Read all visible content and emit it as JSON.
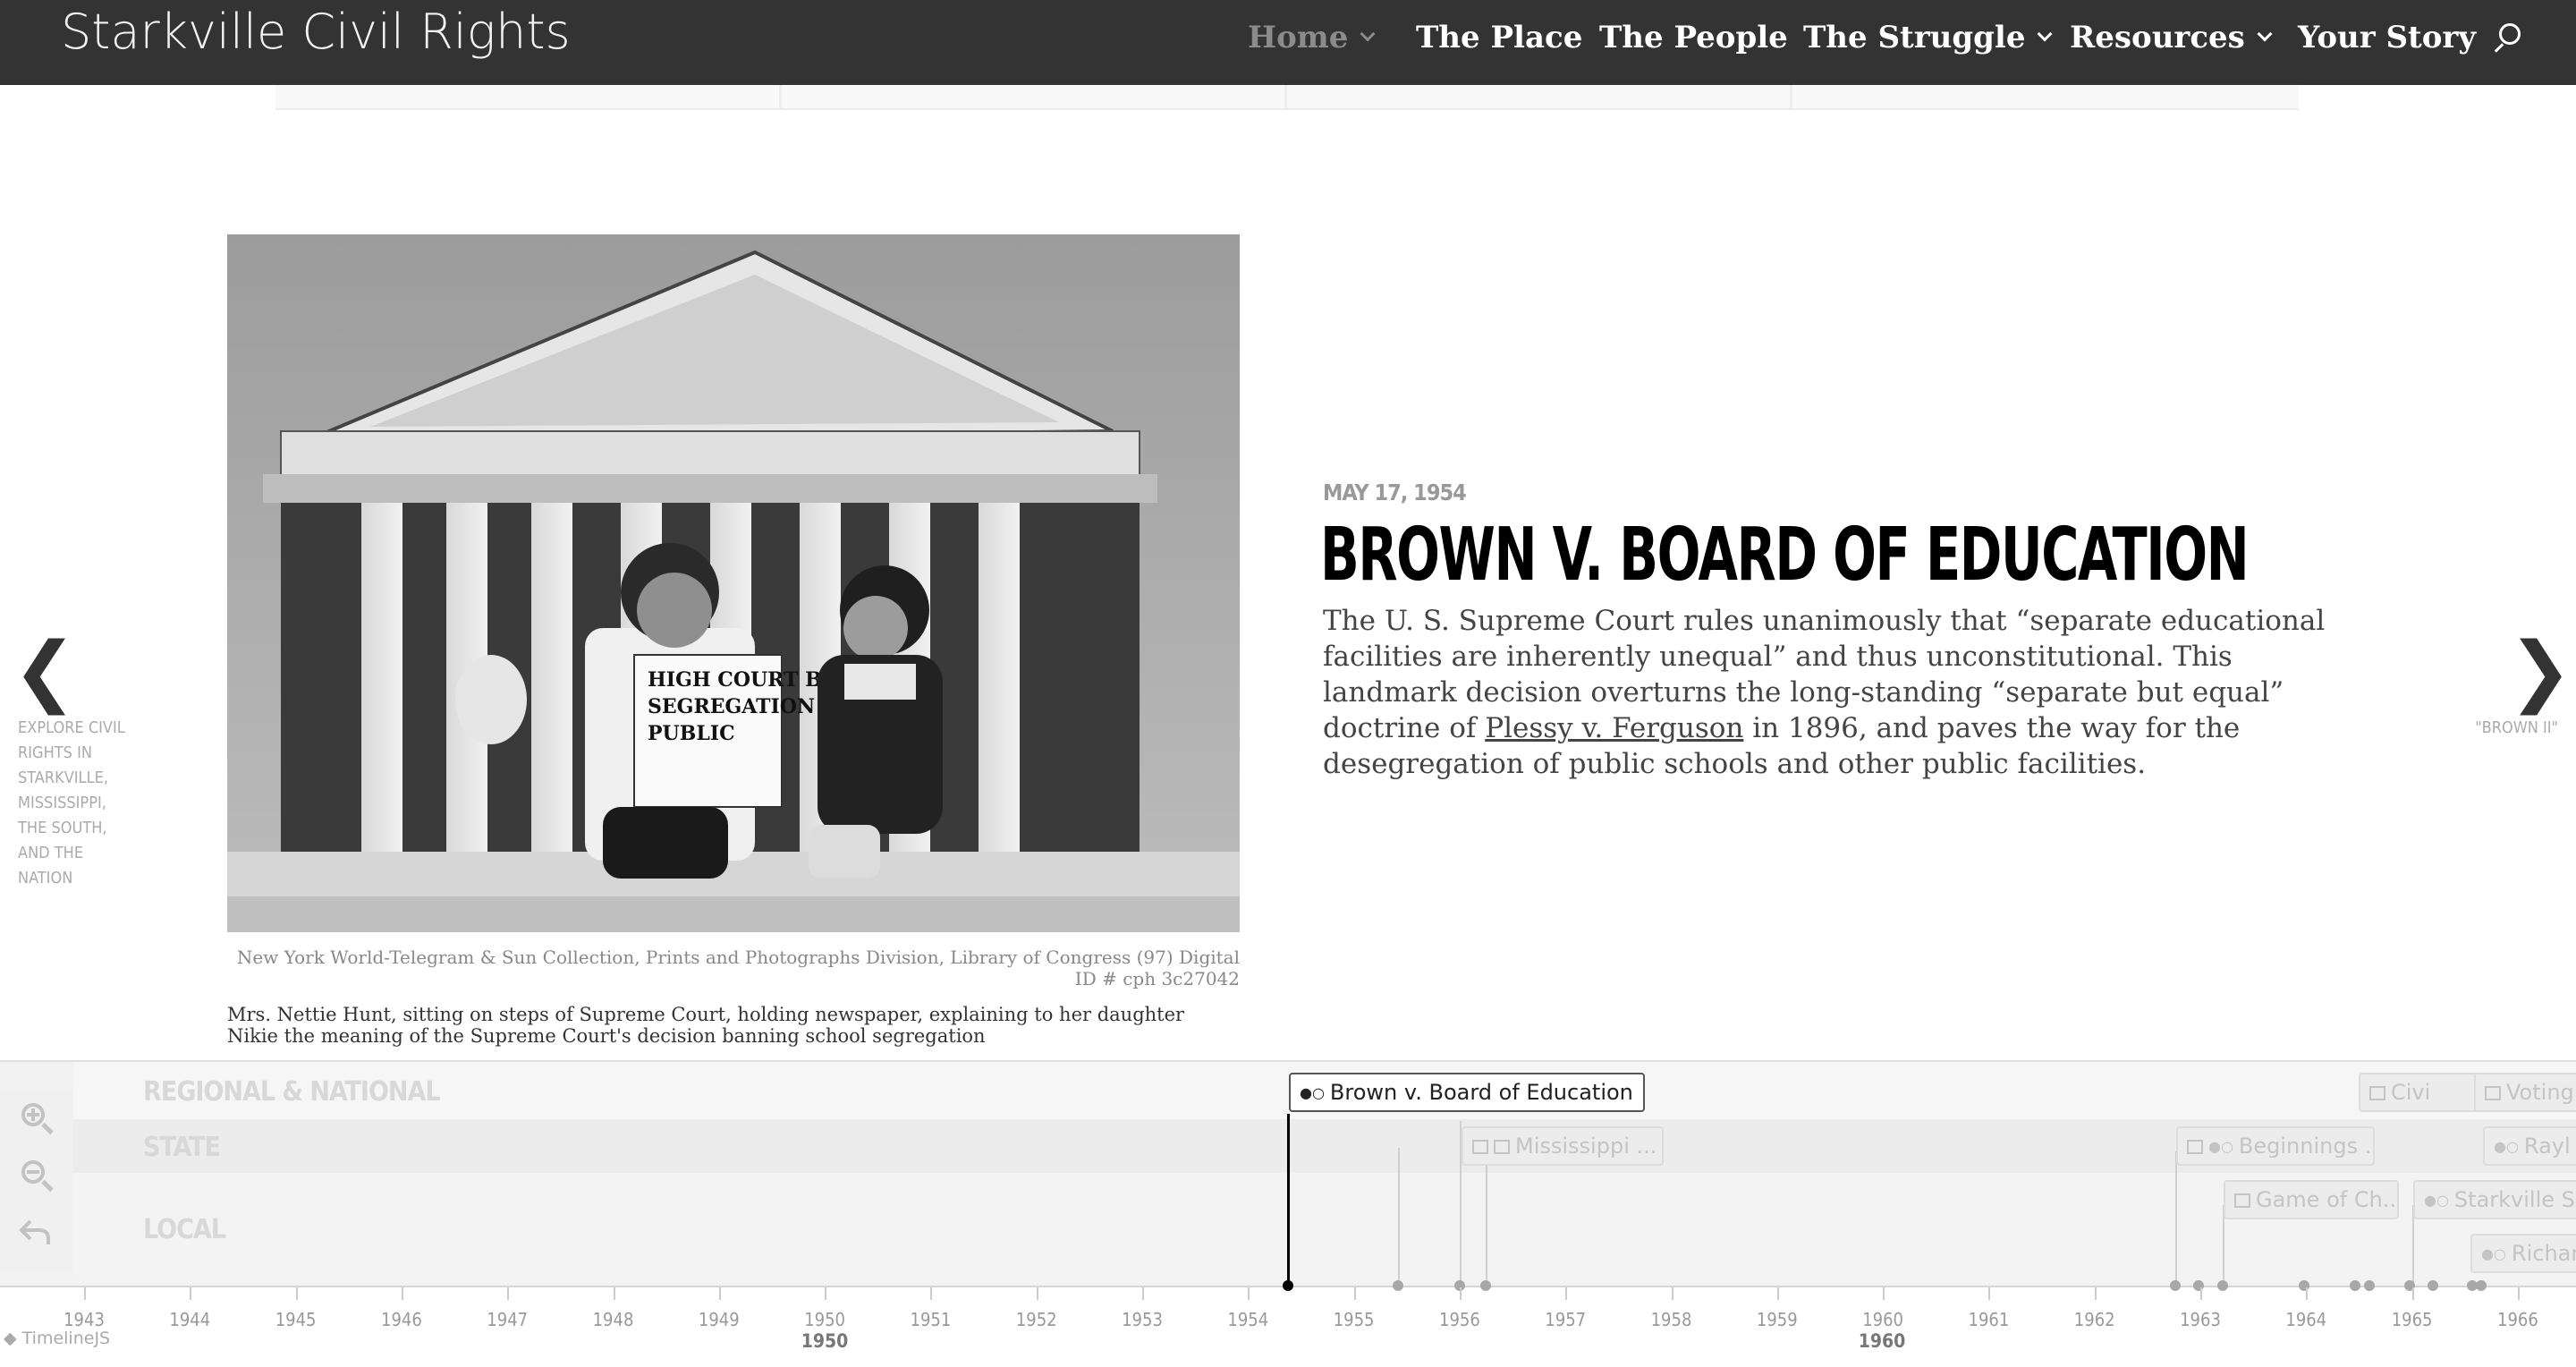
{
  "header": {
    "site_title": "Starkville Civil Rights",
    "nav": [
      {
        "label": "Home",
        "has_dropdown": true,
        "active": true
      },
      {
        "label": "The Place",
        "has_dropdown": false
      },
      {
        "label": "The People",
        "has_dropdown": false
      },
      {
        "label": "The Struggle",
        "has_dropdown": true
      },
      {
        "label": "Resources",
        "has_dropdown": true
      },
      {
        "label": "Your Story",
        "has_dropdown": false
      }
    ],
    "search_icon": "search-icon"
  },
  "slide": {
    "image_alt": "Mrs. Nettie Hunt with daughter Nikie on steps of Supreme Court",
    "newspaper_text": "HIGH COURT BANS SEGREGATION IN PUBLIC",
    "credit": "New York World-Telegram & Sun Collection, Prints and Photographs Division, Library of Congress (97) Digital ID # cph 3c27042",
    "caption": "Mrs. Nettie Hunt, sitting on steps of Supreme Court, holding newspaper, explaining to her daughter Nikie the meaning of the Supreme Court's decision banning school segregation",
    "date": "MAY 17, 1954",
    "headline": "BROWN V. BOARD OF EDUCATION",
    "body_pre": "The U. S. Supreme Court rules unanimously that “separate educational facilities are inherently unequal” and thus unconstitutional. This landmark decision overturns the long-standing “separate but equal” doctrine of ",
    "body_link": "Plessy v. Ferguson",
    "body_post": " in 1896, and paves the way for the desegregation of public schools and other public facilities.",
    "prev_label": "EXPLORE CIVIL RIGHTS IN STARKVILLE, MISSISSIPPI, THE SOUTH, AND THE NATION",
    "next_label": "\"BROWN II\""
  },
  "timeline": {
    "groups": [
      "REGIONAL & NATIONAL",
      "STATE",
      "LOCAL"
    ],
    "markers": [
      {
        "label": "Brown v. Board of Education",
        "active": true
      },
      {
        "label": "Mississippi ..."
      },
      {
        "label": "Beginnings ..."
      },
      {
        "label": "Game of Ch..."
      },
      {
        "label": "Starkville S..."
      },
      {
        "label": "Civi"
      },
      {
        "label": "Voting"
      },
      {
        "label": "Rayl"
      },
      {
        "label": "Richard"
      }
    ],
    "years": [
      "1943",
      "1944",
      "1945",
      "1946",
      "1947",
      "1948",
      "1949",
      "1950",
      "1951",
      "1952",
      "1953",
      "1954",
      "1955",
      "1956",
      "1957",
      "1958",
      "1959",
      "1960",
      "1961",
      "1962",
      "1963",
      "1964",
      "1965",
      "1966"
    ],
    "decades": [
      "1950",
      "1960"
    ],
    "credit": "TimelineJS"
  }
}
